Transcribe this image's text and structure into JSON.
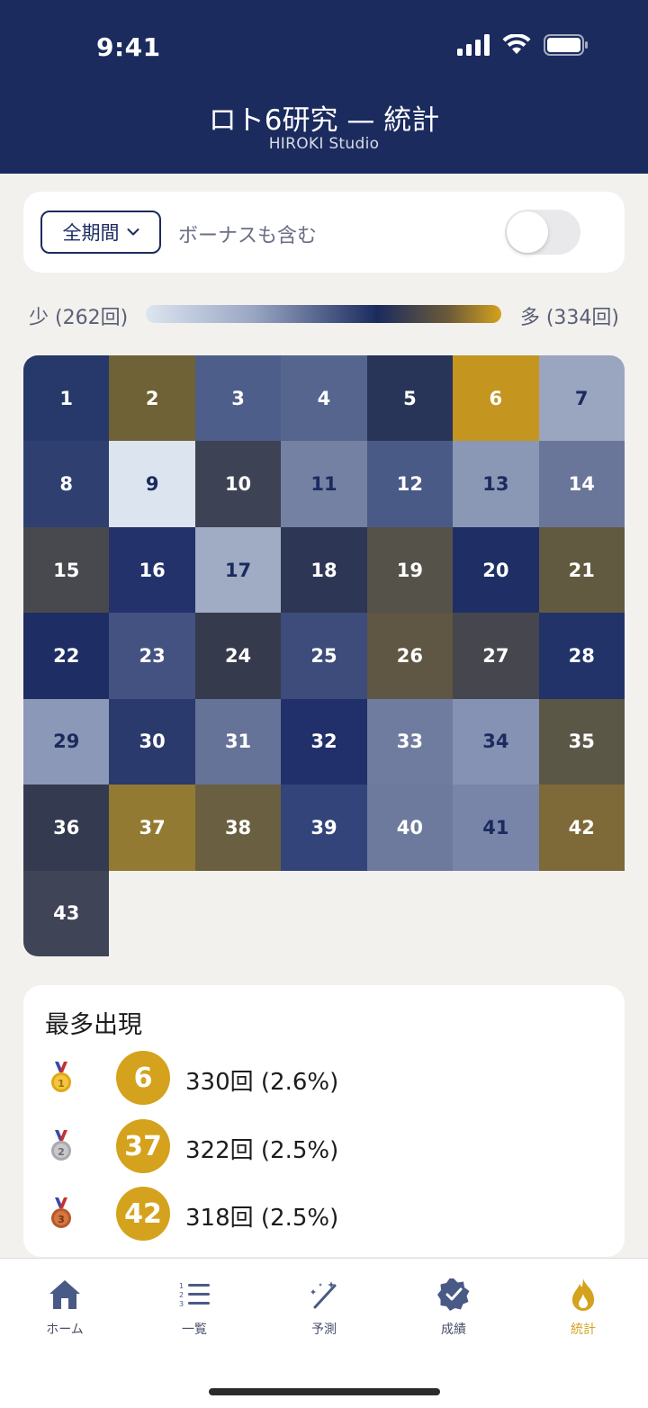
{
  "status_bar": {
    "time": "9:41"
  },
  "header": {
    "title": "ロト6研究 — 統計",
    "subtitle": "HIROKI Studio"
  },
  "filter": {
    "period_label": "全期間",
    "bonus_label": "ボーナスも含む",
    "bonus_toggle_on": false
  },
  "legend": {
    "low_label": "少 (262回)",
    "high_label": "多 (334回)"
  },
  "heatmap": {
    "cells": [
      {
        "n": "1",
        "bg": "#27386a"
      },
      {
        "n": "2",
        "bg": "#706237"
      },
      {
        "n": "3",
        "bg": "#4d5e8a"
      },
      {
        "n": "4",
        "bg": "#55658e"
      },
      {
        "n": "5",
        "bg": "#283458"
      },
      {
        "n": "6",
        "bg": "#c4951f"
      },
      {
        "n": "7",
        "bg": "#9aa5c0",
        "light": true
      },
      {
        "n": "8",
        "bg": "#2e3f70"
      },
      {
        "n": "9",
        "bg": "#dbe4ef",
        "light": true
      },
      {
        "n": "10",
        "bg": "#3d4254"
      },
      {
        "n": "11",
        "bg": "#7481a3",
        "light": true
      },
      {
        "n": "12",
        "bg": "#4a5a86"
      },
      {
        "n": "13",
        "bg": "#8a97b5",
        "light": true
      },
      {
        "n": "14",
        "bg": "#6a7699"
      },
      {
        "n": "15",
        "bg": "#48494f"
      },
      {
        "n": "16",
        "bg": "#23326a"
      },
      {
        "n": "17",
        "bg": "#a0abc4",
        "light": true
      },
      {
        "n": "18",
        "bg": "#2d3654"
      },
      {
        "n": "19",
        "bg": "#55524a"
      },
      {
        "n": "20",
        "bg": "#1f2f65"
      },
      {
        "n": "21",
        "bg": "#615a41"
      },
      {
        "n": "22",
        "bg": "#1e2d63"
      },
      {
        "n": "23",
        "bg": "#435281"
      },
      {
        "n": "24",
        "bg": "#353a4d"
      },
      {
        "n": "25",
        "bg": "#3d4c7a"
      },
      {
        "n": "26",
        "bg": "#5f5643"
      },
      {
        "n": "27",
        "bg": "#46474e"
      },
      {
        "n": "28",
        "bg": "#22336a"
      },
      {
        "n": "29",
        "bg": "#8c98b7",
        "light": true
      },
      {
        "n": "30",
        "bg": "#2a3a6c"
      },
      {
        "n": "31",
        "bg": "#667398"
      },
      {
        "n": "32",
        "bg": "#21306a"
      },
      {
        "n": "33",
        "bg": "#6f7c9f"
      },
      {
        "n": "34",
        "bg": "#8592b3",
        "light": true
      },
      {
        "n": "35",
        "bg": "#5b5747"
      },
      {
        "n": "36",
        "bg": "#343a50"
      },
      {
        "n": "37",
        "bg": "#927a32"
      },
      {
        "n": "38",
        "bg": "#6a6041"
      },
      {
        "n": "39",
        "bg": "#33447a"
      },
      {
        "n": "40",
        "bg": "#6d7a9e"
      },
      {
        "n": "41",
        "bg": "#7885a8",
        "light": true
      },
      {
        "n": "42",
        "bg": "#7d6a38"
      },
      {
        "n": "43",
        "bg": "#3f4457"
      }
    ]
  },
  "top_numbers": {
    "title": "最多出現",
    "items": [
      {
        "rank": "1",
        "number": "6",
        "stat": "330回 (2.6%)",
        "medal": "gold-medal-icon",
        "medal_color": "#e0a818"
      },
      {
        "rank": "2",
        "number": "37",
        "stat": "322回 (2.5%)",
        "medal": "silver-medal-icon",
        "medal_color": "#a8a8ae"
      },
      {
        "rank": "3",
        "number": "42",
        "stat": "318回 (2.5%)",
        "medal": "bronze-medal-icon",
        "medal_color": "#b8582a"
      }
    ]
  },
  "tabbar": {
    "home": "ホーム",
    "list": "一覧",
    "predict": "予測",
    "results": "成績",
    "stats": "統計"
  },
  "colors": {
    "navy": "#1b2b5e",
    "gold": "#d4a21c"
  }
}
